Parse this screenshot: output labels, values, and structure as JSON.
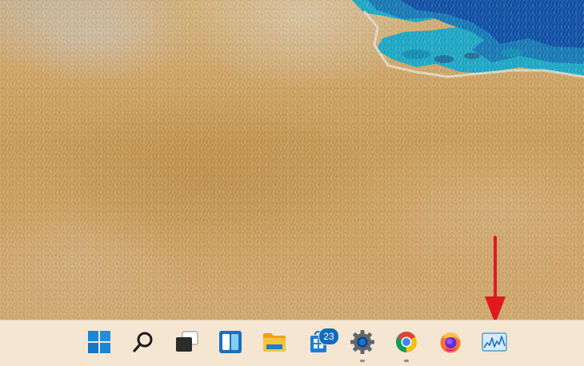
{
  "wallpaper": {
    "description_icon": "sand-beach-wallpaper"
  },
  "taskbar": {
    "background": "#f5e6d2",
    "items": [
      {
        "name": "start",
        "icon": "windows-logo-icon",
        "running": false
      },
      {
        "name": "search",
        "icon": "search-icon",
        "running": false
      },
      {
        "name": "task-view",
        "icon": "task-view-icon",
        "running": false
      },
      {
        "name": "widgets",
        "icon": "widgets-icon",
        "running": false
      },
      {
        "name": "file-explorer",
        "icon": "folder-icon",
        "running": false
      },
      {
        "name": "microsoft-store",
        "icon": "store-icon",
        "running": false,
        "badge": "23"
      },
      {
        "name": "settings",
        "icon": "gear-icon",
        "running": true
      },
      {
        "name": "chrome",
        "icon": "chrome-icon",
        "running": true
      },
      {
        "name": "firefox",
        "icon": "firefox-icon",
        "running": false
      },
      {
        "name": "resource-monitor",
        "icon": "performance-graph-icon",
        "running": false
      }
    ]
  },
  "annotation": {
    "icon": "red-arrow-down-icon",
    "color": "#e0191f"
  },
  "colors": {
    "accent": "#0f6cbd",
    "arrow": "#e0191f"
  }
}
